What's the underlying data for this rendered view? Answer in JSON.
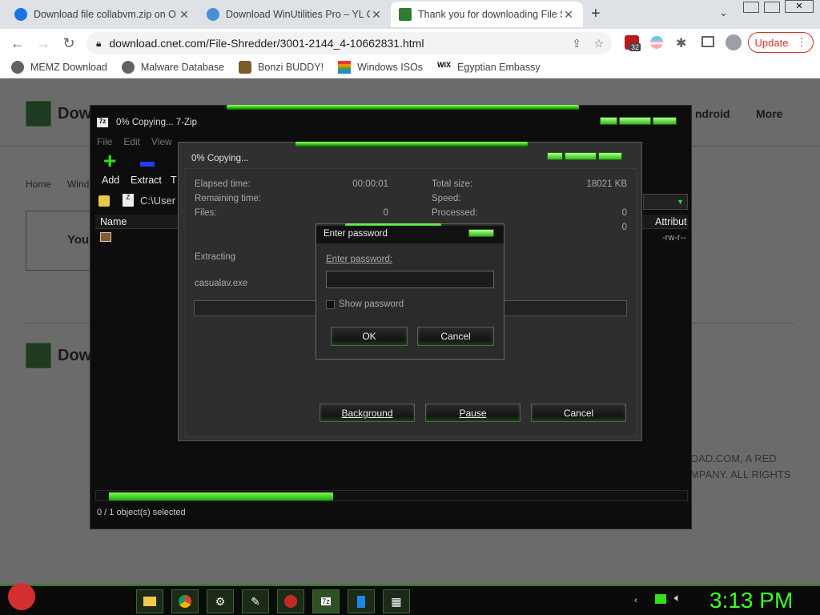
{
  "browser": {
    "tabs": [
      {
        "title": "Download file collabvm.zip on O",
        "favicon_color": "#1a73e8"
      },
      {
        "title": "Download WinUtilities Pro – YL C",
        "favicon_color": "#4a90d9"
      },
      {
        "title": "Thank you for downloading File S",
        "favicon_color": "#2e7d32"
      }
    ],
    "new_tab": "+",
    "url": "download.cnet.com/File-Shredder/3001-2144_4-10662831.html",
    "extension_badge": "32",
    "update_label": "Update",
    "bookmarks": [
      {
        "label": "MEMZ Download",
        "icon": "globe-icon"
      },
      {
        "label": "Malware Database",
        "icon": "globe-icon"
      },
      {
        "label": "Bonzi BUDDY!",
        "icon": "bonzi-icon"
      },
      {
        "label": "Windows ISOs",
        "icon": "windows-logo-icon"
      },
      {
        "label": "Egyptian Embassy",
        "icon": "wix-icon"
      }
    ]
  },
  "page_behind": {
    "logo_text": "Dow",
    "nav_android": "ndroid",
    "nav_more": "More",
    "breadcrumb_home": "Home",
    "breadcrumb_next": "Wind",
    "you_text": "You",
    "footer_line1": "OAD.COM, A RED",
    "footer_line2": "MPANY. ALL RIGHTS"
  },
  "zip_window": {
    "title": "0% Copying... 7-Zip",
    "menu": [
      "File",
      "Edit",
      "View"
    ],
    "tool_add": "Add",
    "tool_extract": "Extract",
    "tool_test": "T",
    "path": "C:\\User",
    "col_name": "Name",
    "col_attrib": "Attribut",
    "attr_value": "-rw-r--",
    "status": "0 / 1 object(s) selected"
  },
  "copy_dialog": {
    "title": "0% Copying...",
    "elapsed_label": "Elapsed time:",
    "elapsed_value": "00:00:01",
    "remaining_label": "Remaining time:",
    "files_label": "Files:",
    "files_value": "0",
    "total_label": "Total size:",
    "total_value": "18021 KB",
    "speed_label": "Speed:",
    "processed_label": "Processed:",
    "processed_value": "0",
    "extra_value": "0",
    "extracting": "Extracting",
    "filename": "casualav.exe",
    "progress": 0,
    "btn_background": "Background",
    "btn_pause": "Pause",
    "btn_cancel": "Cancel"
  },
  "password_dialog": {
    "title": "Enter password",
    "label": "Enter password:",
    "value": "",
    "show_password": "Show password",
    "show_checked": false,
    "ok": "OK",
    "cancel": "Cancel"
  },
  "taskbar": {
    "clock": "3:13 PM"
  }
}
